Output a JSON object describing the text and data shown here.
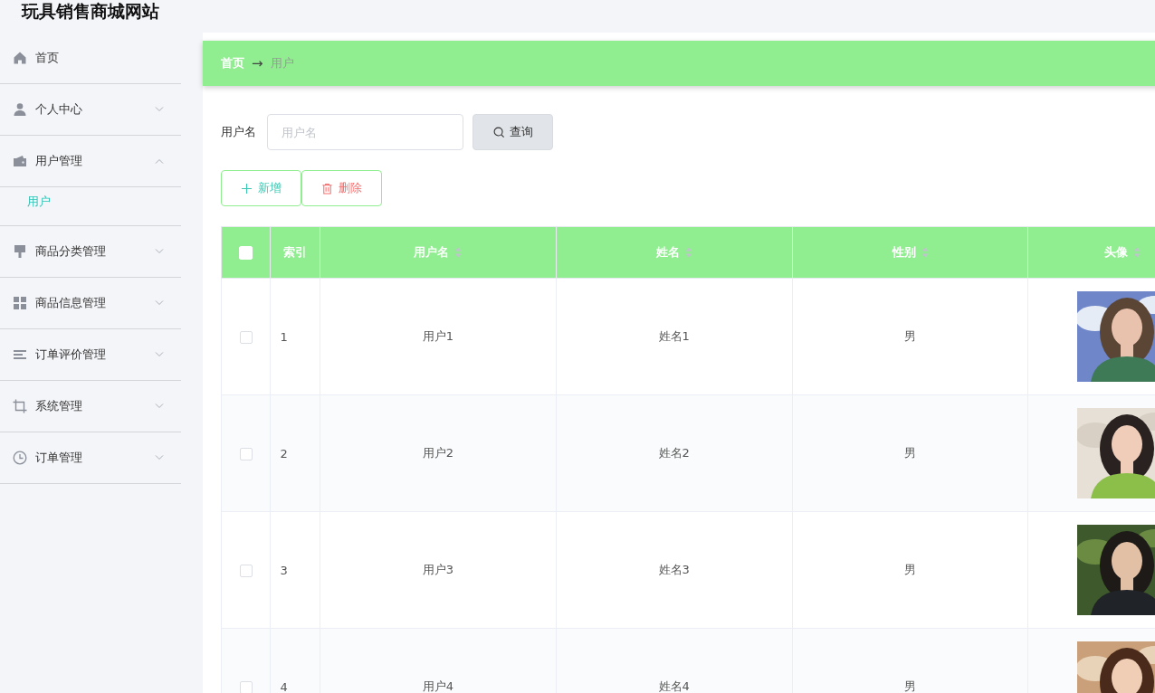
{
  "header": {
    "title": "玩具销售商城网站"
  },
  "sidebar": {
    "items": [
      {
        "label": "首页"
      },
      {
        "label": "个人中心",
        "expanded": false
      },
      {
        "label": "用户管理",
        "expanded": true,
        "children": [
          {
            "label": "用户",
            "selected": true
          }
        ]
      },
      {
        "label": "商品分类管理",
        "expanded": false
      },
      {
        "label": "商品信息管理",
        "expanded": false
      },
      {
        "label": "订单评价管理",
        "expanded": false
      },
      {
        "label": "系统管理",
        "expanded": false
      },
      {
        "label": "订单管理",
        "expanded": false
      }
    ]
  },
  "breadcrumb": {
    "items": [
      "首页",
      "用户"
    ],
    "separator": "→"
  },
  "search": {
    "label": "用户名",
    "placeholder": "用户名",
    "button": "查询"
  },
  "actions": {
    "add": "新增",
    "delete": "删除"
  },
  "table": {
    "all_checked": false,
    "columns": [
      {
        "label": "索引",
        "sortable": false
      },
      {
        "label": "用户名",
        "sortable": true
      },
      {
        "label": "姓名",
        "sortable": true
      },
      {
        "label": "性别",
        "sortable": true
      },
      {
        "label": "头像",
        "sortable": true
      }
    ],
    "rows": [
      {
        "checked": false,
        "index": "1",
        "username": "用户1",
        "name": "姓名1",
        "gender": "男"
      },
      {
        "checked": false,
        "index": "2",
        "username": "用户2",
        "name": "姓名2",
        "gender": "男"
      },
      {
        "checked": false,
        "index": "3",
        "username": "用户3",
        "name": "姓名3",
        "gender": "男"
      },
      {
        "checked": false,
        "index": "4",
        "username": "用户4",
        "name": "姓名4",
        "gender": "男"
      }
    ]
  }
}
